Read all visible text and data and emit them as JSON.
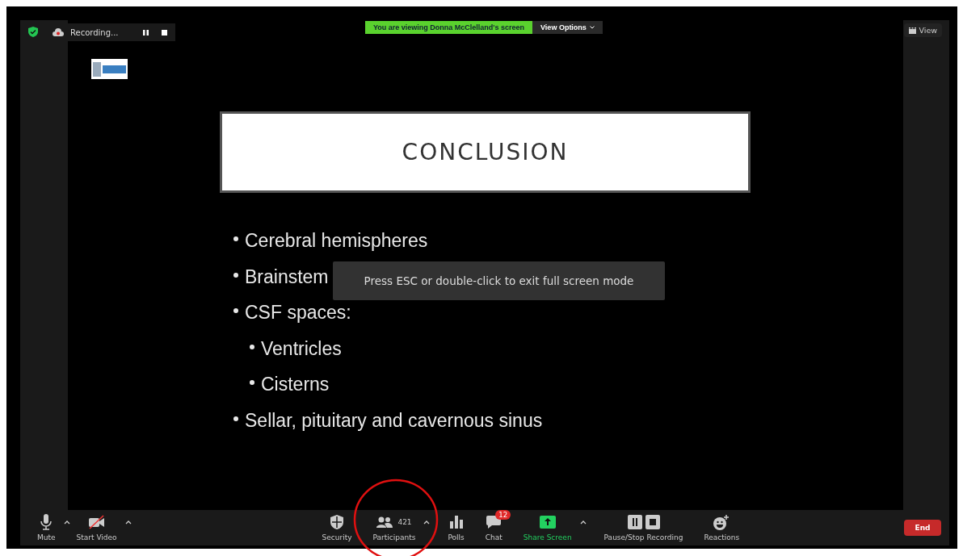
{
  "top_bar": {
    "recording_label": "Recording...",
    "banner": "You are viewing Donna McClelland's screen",
    "view_options": "View Options",
    "view_button": "View"
  },
  "slide": {
    "title": "CONCLUSION",
    "bullets": [
      {
        "text": "Cerebral hemispheres"
      },
      {
        "text": "Brainstem"
      },
      {
        "text": "CSF spaces:",
        "children": [
          {
            "text": "Ventricles"
          },
          {
            "text": "Cisterns"
          }
        ]
      },
      {
        "text": "Sellar, pituitary and cavernous sinus"
      }
    ]
  },
  "toast": "Press ESC or double-click to exit full screen mode",
  "toolbar": {
    "left": [
      {
        "kind": "mic",
        "label": "Mute",
        "caret": true,
        "highlighted": false
      },
      {
        "kind": "video-off",
        "label": "Start Video",
        "caret": true,
        "highlighted": false
      }
    ],
    "center": [
      {
        "kind": "security",
        "label": "Security",
        "caret": false,
        "highlighted": false
      },
      {
        "kind": "participants",
        "label": "Participants",
        "count": "421",
        "caret": true,
        "highlighted": false
      },
      {
        "kind": "polls",
        "label": "Polls",
        "caret": false,
        "highlighted": false
      },
      {
        "kind": "chat",
        "label": "Chat",
        "badge": "12",
        "caret": false,
        "highlighted": false
      },
      {
        "kind": "share",
        "label": "Share Screen",
        "caret": true,
        "highlighted": true
      },
      {
        "kind": "record",
        "label": "Pause/Stop Recording",
        "caret": false,
        "highlighted": false
      },
      {
        "kind": "reactions",
        "label": "Reactions",
        "caret": false,
        "highlighted": false
      }
    ],
    "end_button": "End"
  }
}
